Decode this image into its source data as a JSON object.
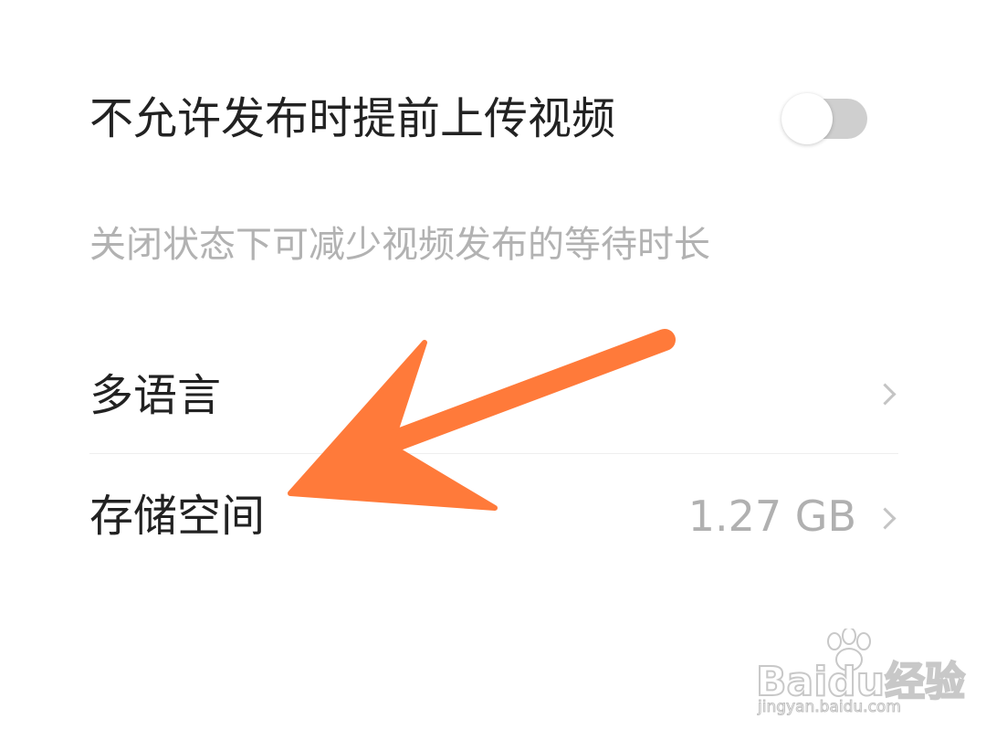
{
  "settings": {
    "upload_toggle": {
      "label": "不允许发布时提前上传视频",
      "state": "off"
    },
    "upload_hint": "关闭状态下可减少视频发布的等待时长",
    "language": {
      "label": "多语言"
    },
    "storage": {
      "label": "存储空间",
      "value": "1.27 GB"
    }
  },
  "annotation": {
    "arrow_color": "#ff7a3a"
  },
  "watermark": {
    "brand": "Baidu经验",
    "url": "jingyan.baidu.com"
  },
  "colors": {
    "background": "#ffffff",
    "title_text": "#222222",
    "hint_text": "#b2b2b2",
    "toggle_off_track": "#cfcfcf"
  }
}
